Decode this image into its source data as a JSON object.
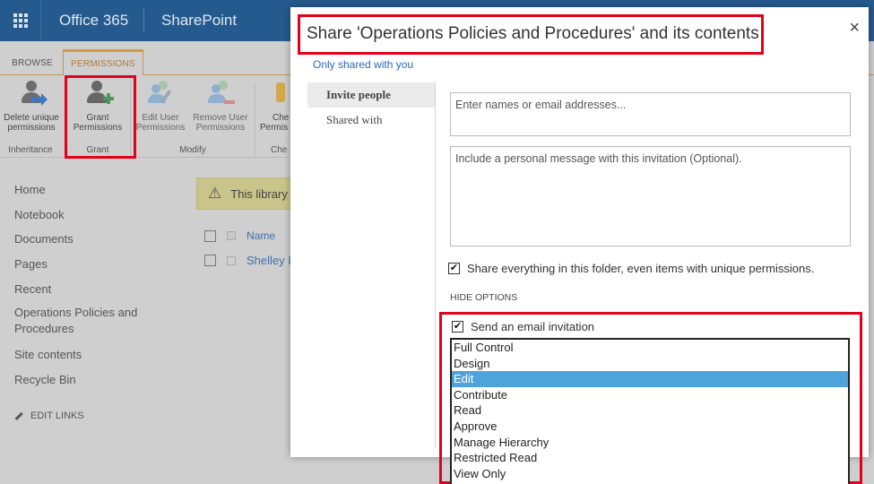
{
  "suitebar": {
    "app_launcher_icon": "waffle-icon",
    "office_label": "Office 365",
    "product_label": "SharePoint"
  },
  "ribbon": {
    "tabs": [
      {
        "label": "BROWSE",
        "active": false
      },
      {
        "label": "PERMISSIONS",
        "active": true
      }
    ],
    "buttons": [
      {
        "label_line1": "Delete unique",
        "label_line2": "permissions",
        "icon": "delete-permissions-icon",
        "group": "Inheritance",
        "enabled": true
      },
      {
        "label_line1": "Grant",
        "label_line2": "Permissions",
        "icon": "grant-permissions-icon",
        "group": "Grant",
        "enabled": true,
        "highlighted": true
      },
      {
        "label_line1": "Edit User",
        "label_line2": "Permissions",
        "icon": "edit-user-permissions-icon",
        "group": "Modify",
        "enabled": false
      },
      {
        "label_line1": "Remove User",
        "label_line2": "Permissions",
        "icon": "remove-user-permissions-icon",
        "group": "Modify",
        "enabled": false
      },
      {
        "label_line1": "Che",
        "label_line2": "Permis",
        "icon": "check-permissions-icon",
        "group": "Che",
        "enabled": true
      }
    ],
    "groups": [
      "Inheritance",
      "Grant",
      "Modify",
      "Che"
    ]
  },
  "nav": {
    "items": [
      "Home",
      "Notebook",
      "Documents",
      "Pages",
      "Recent",
      "Operations Policies and Procedures",
      "Site contents",
      "Recycle Bin"
    ],
    "edit_links": "EDIT LINKS"
  },
  "content": {
    "warning_text": "This library",
    "list_header": "Name",
    "list_rows": [
      "Shelley I"
    ]
  },
  "dialog": {
    "title": "Share 'Operations Policies and Procedures' and its contents",
    "close_label": "×",
    "shared_status": "Only shared with you",
    "tabs": [
      {
        "label": "Invite people",
        "active": true
      },
      {
        "label": "Shared with",
        "active": false
      }
    ],
    "names_placeholder": "Enter names or email addresses...",
    "message_placeholder": "Include a personal message with this invitation (Optional).",
    "share_everything": {
      "label": "Share everything in this folder, even items with unique permissions.",
      "checked": true
    },
    "hide_options": "HIDE OPTIONS",
    "send_email": {
      "label": "Send an email invitation",
      "checked": true
    },
    "permission_levels": [
      "Full Control",
      "Design",
      "Edit",
      "Contribute",
      "Read",
      "Approve",
      "Manage Hierarchy",
      "Restricted Read",
      "View Only"
    ],
    "selected_permission": "Edit"
  },
  "colors": {
    "suitebar": "#255a8f",
    "highlight_red": "#e3001b",
    "selected_blue": "#4ea3dc",
    "link_blue": "#2a6ab8",
    "ribbon_accent": "#d69a46"
  }
}
